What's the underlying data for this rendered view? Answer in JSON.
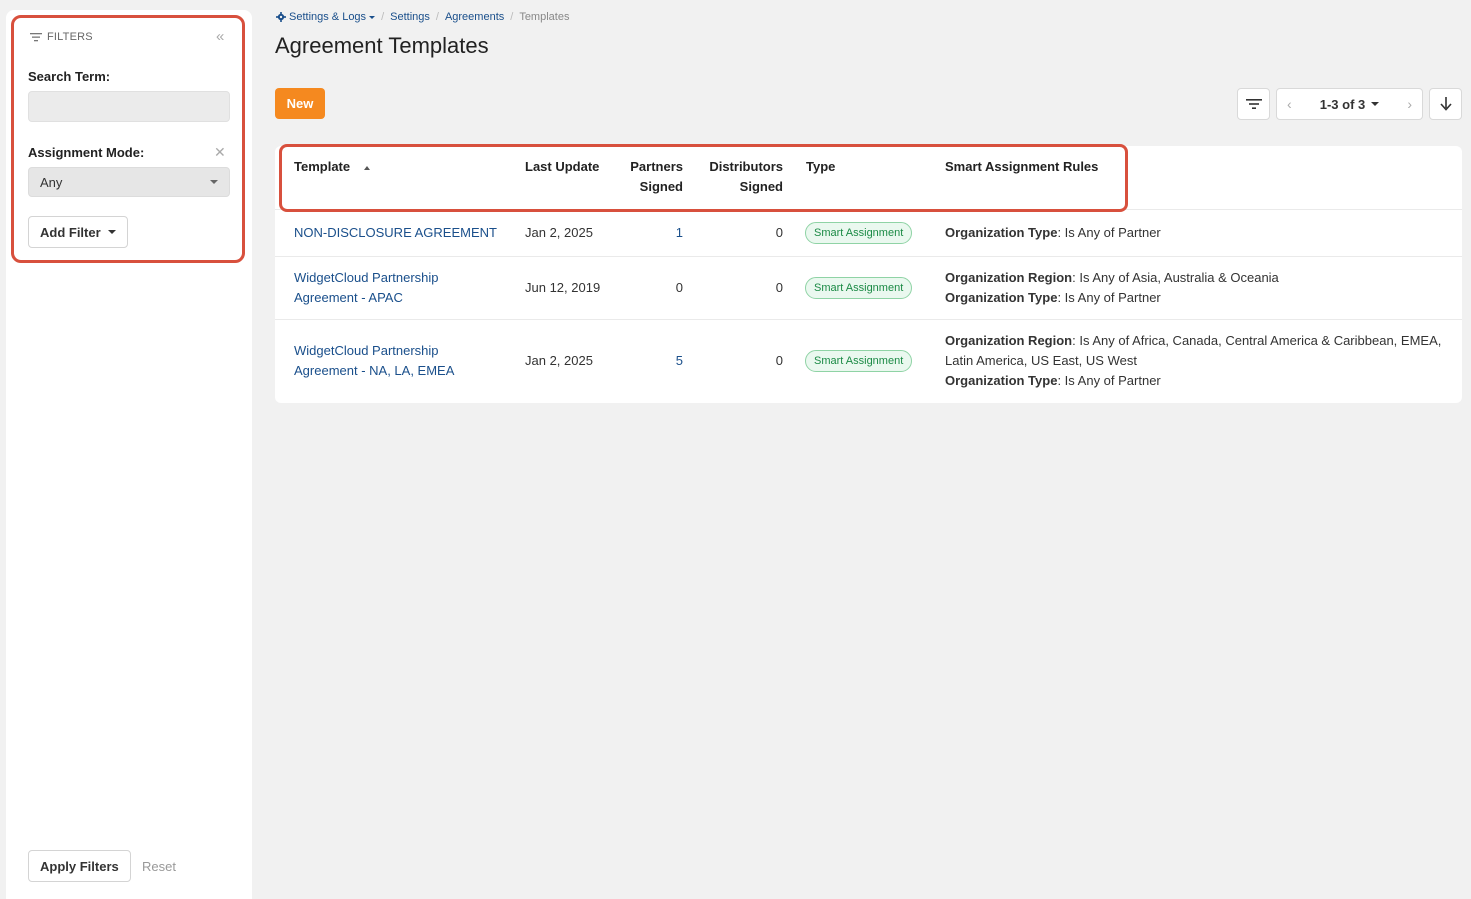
{
  "filters": {
    "header_label": "FILTERS",
    "search_label": "Search Term:",
    "search_value": "",
    "search_placeholder": "",
    "assignment_label": "Assignment Mode:",
    "assignment_value": "Any",
    "add_filter_label": "Add Filter",
    "apply_label": "Apply Filters",
    "reset_label": "Reset"
  },
  "breadcrumb": {
    "items": [
      "Settings & Logs",
      "Settings",
      "Agreements"
    ],
    "current": "Templates"
  },
  "page": {
    "title": "Agreement Templates",
    "new_label": "New"
  },
  "pager": {
    "label": "1-3 of 3"
  },
  "table": {
    "columns": {
      "template": "Template",
      "last_update": "Last Update",
      "partners_1": "Partners",
      "partners_2": "Signed",
      "distributors_1": "Distributors",
      "distributors_2": "Signed",
      "type": "Type",
      "rules": "Smart Assignment Rules"
    },
    "rows": [
      {
        "name_1": "NON-DISCLOSURE AGREEMENT",
        "name_2": "",
        "last_update": "Jan 2, 2025",
        "partners": "1",
        "distributors": "0",
        "type": "Smart Assignment",
        "rules": [
          {
            "key": "Organization Type",
            "value": ": Is Any of Partner"
          }
        ]
      },
      {
        "name_1": "WidgetCloud Partnership",
        "name_2": "Agreement - APAC",
        "last_update": "Jun 12, 2019",
        "partners": "0",
        "distributors": "0",
        "type": "Smart Assignment",
        "rules": [
          {
            "key": "Organization Region",
            "value": ": Is Any of Asia, Australia & Oceania"
          },
          {
            "key": "Organization Type",
            "value": ": Is Any of Partner"
          }
        ]
      },
      {
        "name_1": "WidgetCloud Partnership",
        "name_2": "Agreement - NA, LA, EMEA",
        "last_update": "Jan 2, 2025",
        "partners": "5",
        "distributors": "0",
        "type": "Smart Assignment",
        "rules": [
          {
            "key": "Organization Region",
            "value": ": Is Any of Africa, Canada, Central America & Caribbean, EMEA,"
          },
          {
            "key": "",
            "value": "Latin America, US East, US West"
          },
          {
            "key": "Organization Type",
            "value": ": Is Any of Partner"
          }
        ]
      }
    ]
  },
  "colors": {
    "accent": "#f5891f",
    "link": "#1a4f8b",
    "highlight": "#d8503d",
    "badge_text": "#1b8a45"
  },
  "icons": [
    "filter-icon",
    "collapse-icon",
    "clear-icon",
    "gear-icon",
    "chevron-left-icon",
    "chevron-right-icon",
    "download-icon",
    "sort-asc-icon"
  ]
}
